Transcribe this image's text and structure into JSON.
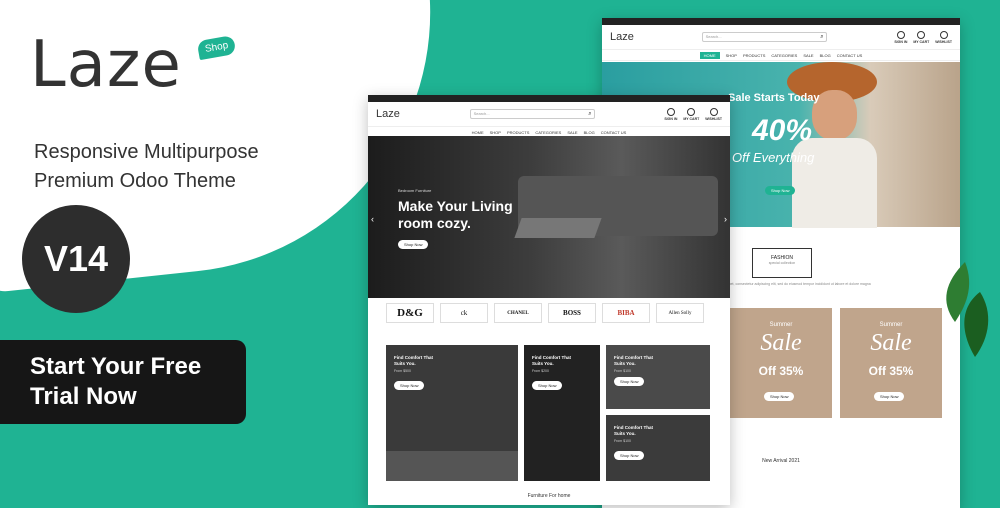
{
  "brand": {
    "name_part1": "L",
    "name_part2": "aze",
    "badge": "Shop"
  },
  "tagline": {
    "line1": "Responsive Multipurpose",
    "line2": "Premium Odoo Theme"
  },
  "version": "V14",
  "cta": {
    "line1": "Start Your Free",
    "line2": "Trial Now"
  },
  "mock1": {
    "logo": "Laze",
    "search_placeholder": "Search...",
    "icons": [
      "SIGN IN",
      "MY CART",
      "WISHLIST"
    ],
    "nav": [
      "HOME",
      "SHOP",
      "PRODUCTS",
      "CATEGORIES",
      "SALE",
      "BLOG",
      "CONTACT US"
    ],
    "hero": {
      "sub": "Bedroom Furniture",
      "heading": "Make Your Living room cozy.",
      "button": "Shop Now"
    },
    "brands": [
      "D&G",
      "ck",
      "CHANEL",
      "BOSS",
      "BIBA",
      "Allen Solly"
    ],
    "tiles": [
      {
        "title": "Find Comfort That Suits You.",
        "price": "From $500",
        "button": "Shop Now"
      },
      {
        "title": "Find Comfort That Suits You.",
        "price": "From $200",
        "button": "Shop Now"
      },
      {
        "title": "Find Comfort That Suits You.",
        "price": "From $100",
        "button": "Shop Now"
      },
      {
        "title": "Find Comfort That Suits You.",
        "price": "From $100",
        "button": "Shop Now"
      }
    ],
    "bottom_text": "Furniture For home"
  },
  "mock2": {
    "logo": "Laze",
    "search_placeholder": "Search...",
    "icons": [
      "SIGN IN",
      "MY CART",
      "WISHLIST"
    ],
    "nav": [
      "HOME",
      "SHOP",
      "PRODUCTS",
      "CATEGORIES",
      "SALE",
      "BLOG",
      "CONTACT US"
    ],
    "hero": {
      "line1": "Sale Starts Today",
      "line2": "40%",
      "line3": "Off Everything",
      "button": "Shop Now"
    },
    "fashion": {
      "title": "FASHION",
      "sub": "special collection"
    },
    "desc": "Lorem ipsum dolor sit amet, consectetur adipiscing elit, sed do eiusmod tempor incididunt ut labore et dolore magna",
    "sales": [
      {
        "small": "Summer",
        "big": "Sale",
        "off": "Off 35%",
        "button": "Shop Now"
      },
      {
        "small": "Summer",
        "big": "Sale",
        "off": "Off 35%",
        "button": "Shop Now"
      }
    ],
    "new_arrival": "New Arrival 2021"
  },
  "colors": {
    "accent": "#1fb393",
    "dark": "#161616",
    "text": "#333333"
  }
}
